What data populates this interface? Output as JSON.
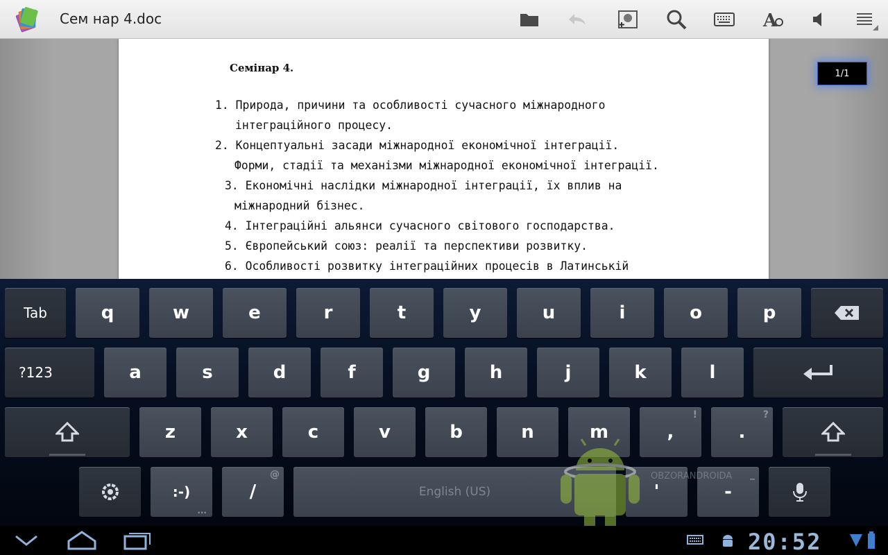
{
  "app": {
    "title": "Сем нар 4.doc",
    "icons": [
      "folder-icon",
      "undo-icon",
      "add-image-icon",
      "search-icon",
      "keyboard-icon",
      "text-format-icon",
      "speaker-icon",
      "menu-icon"
    ]
  },
  "document": {
    "heading": "Семінар 4.",
    "lines": [
      "1. Природа, причини та особливості сучасного міжнародного",
      "інтеграційного процесу.",
      "2. Концептуальні засади міжнародної економічної інтеграції.",
      "Форми, стадії та механізми міжнародної економічної інтеграції.",
      "3. Економічні наслідки міжнародної інтеграції, їх вплив на",
      "міжнародний бізнес.",
      "4. Інтеграційні альянси сучасного світового господарства.",
      "5. Європейський союз: реалії та перспективи розвитку.",
      "6. Особливості розвитку інтеграційних процесів в Латинській"
    ],
    "page_indicator": "1/1"
  },
  "keyboard": {
    "row1": [
      "Tab",
      "q",
      "w",
      "e",
      "r",
      "t",
      "y",
      "u",
      "i",
      "o",
      "p"
    ],
    "row2": [
      "?123",
      "a",
      "s",
      "d",
      "f",
      "g",
      "h",
      "j",
      "k",
      "l"
    ],
    "row3": [
      "z",
      "x",
      "c",
      "v",
      "b",
      "n",
      "m",
      ",",
      "."
    ],
    "row3_hints": [
      "!",
      "?"
    ],
    "row4": {
      "emoticon": ":-)",
      "slash": "/",
      "slash_hint": "@",
      "space": "English (US)",
      "apostrophe": "'",
      "dash": "-",
      "dash_hint": "_"
    }
  },
  "watermark": "OBZORANDROIDA",
  "status": {
    "clock": "20:52"
  },
  "colors": {
    "key_face": "#434a55",
    "function_key_face": "#2b3039",
    "page_indicator_glow": "#3c78ff"
  }
}
